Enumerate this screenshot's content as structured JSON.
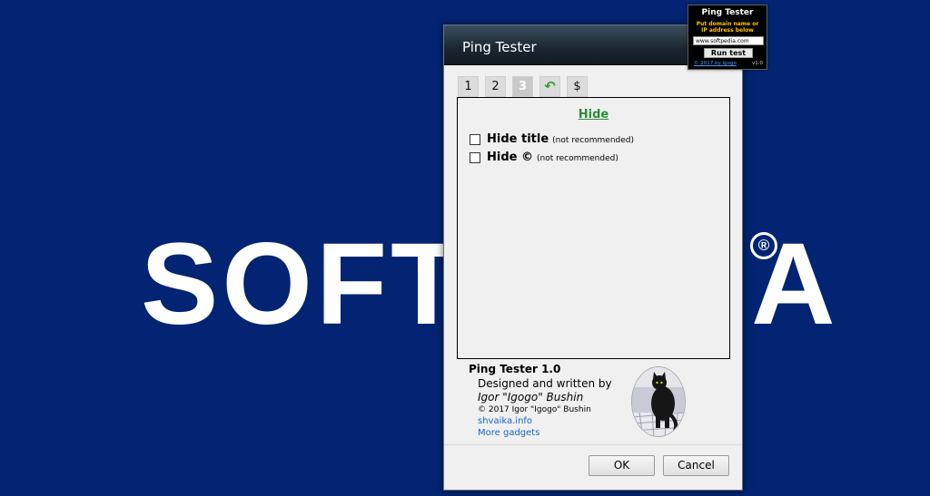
{
  "wallpaper": {
    "logo_text": "SOFTPEDIA",
    "registered_mark": "®"
  },
  "dialog": {
    "title": "Ping Tester",
    "tabs": [
      {
        "label": "1",
        "active": false
      },
      {
        "label": "2",
        "active": false
      },
      {
        "label": "3",
        "active": true
      },
      {
        "label": "",
        "icon": "refresh-arrow-icon",
        "active": false
      },
      {
        "label": "$",
        "active": false
      }
    ],
    "panel": {
      "heading": "Hide",
      "options": [
        {
          "label": "Hide title",
          "note": "(not recommended)",
          "checked": false
        },
        {
          "label": "Hide ©",
          "note": "(not recommended)",
          "checked": false
        }
      ]
    },
    "about": {
      "name": "Ping Tester 1.0",
      "designed_by": "Designed and written by",
      "author": "Igor \"Igogo\" Bushin",
      "copyright": "© 2017 Igor \"Igogo\" Bushin",
      "link_site": "shvaika.info",
      "link_more": "More gadgets"
    },
    "buttons": {
      "ok": "OK",
      "cancel": "Cancel"
    }
  },
  "gadget": {
    "title": "Ping Tester",
    "hint_line1": "Put domain name or",
    "hint_line2": "IP address below",
    "input_value": "www.softpedia.com",
    "run_button": "Run test",
    "copyright_link": "© 2017 by Igogo",
    "version": "v1.0"
  },
  "colors": {
    "desktop_bg": "#022472",
    "accent_green": "#2e8b3b",
    "link_blue": "#1565c0",
    "gadget_hint": "#ffc400"
  }
}
